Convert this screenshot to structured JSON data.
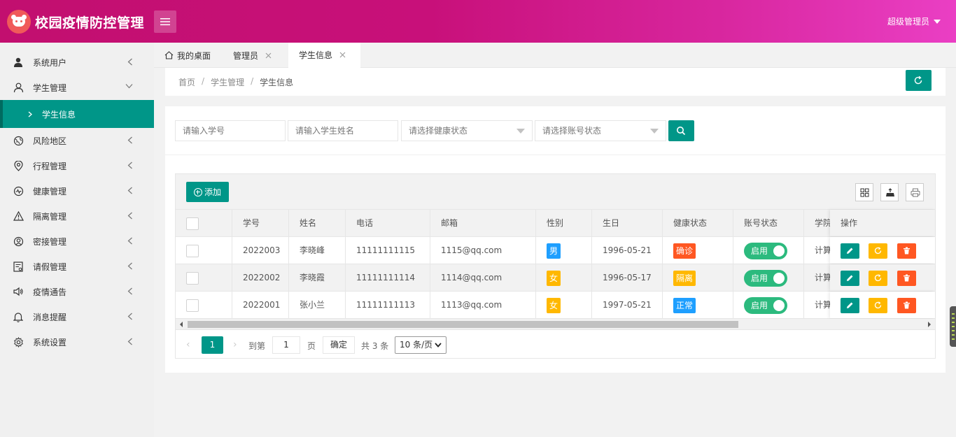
{
  "app": {
    "title": "校园疫情防控管理",
    "user": "超级管理员"
  },
  "sidebar": {
    "items": [
      {
        "label": "系统用户",
        "icon": "user-icon"
      },
      {
        "label": "学生管理",
        "icon": "person-outline-icon",
        "expanded": true
      },
      {
        "label": "风险地区",
        "icon": "globe-icon"
      },
      {
        "label": "行程管理",
        "icon": "location-icon"
      },
      {
        "label": "健康管理",
        "icon": "pulse-icon"
      },
      {
        "label": "隔离管理",
        "icon": "warning-icon"
      },
      {
        "label": "密接管理",
        "icon": "contact-icon"
      },
      {
        "label": "请假管理",
        "icon": "form-icon"
      },
      {
        "label": "疫情通告",
        "icon": "speaker-icon"
      },
      {
        "label": "消息提醒",
        "icon": "bell-icon"
      },
      {
        "label": "系统设置",
        "icon": "gear-icon"
      }
    ],
    "active_sub": "学生信息"
  },
  "tabs": [
    {
      "label": "我的桌面"
    },
    {
      "label": "管理员"
    },
    {
      "label": "学生信息",
      "active": true
    }
  ],
  "breadcrumb": {
    "home": "首页",
    "parent": "学生管理",
    "current": "学生信息",
    "sep": "/"
  },
  "filters": {
    "student_id_placeholder": "请输入学号",
    "student_name_placeholder": "请输入学生姓名",
    "health_status_placeholder": "请选择健康状态",
    "account_status_placeholder": "请选择账号状态"
  },
  "toolbar": {
    "add_label": "添加"
  },
  "table": {
    "columns": [
      "学号",
      "姓名",
      "电话",
      "邮箱",
      "性别",
      "生日",
      "健康状态",
      "账号状态",
      "学院",
      "操作"
    ],
    "rows": [
      {
        "id": "2022003",
        "name": "李晓峰",
        "phone": "11111111115",
        "email": "1115@qq.com",
        "gender": "男",
        "birthday": "1996-05-21",
        "health": "确诊",
        "account": "启用",
        "college": "计算"
      },
      {
        "id": "2022002",
        "name": "李晓霞",
        "phone": "11111111114",
        "email": "1114@qq.com",
        "gender": "女",
        "birthday": "1996-05-17",
        "health": "隔离",
        "account": "启用",
        "college": "计算"
      },
      {
        "id": "2022001",
        "name": "张小兰",
        "phone": "11111111113",
        "email": "1113@qq.com",
        "gender": "女",
        "birthday": "1997-05-21",
        "health": "正常",
        "account": "启用",
        "college": "计算"
      }
    ]
  },
  "pagination": {
    "current_page": "1",
    "goto_label": "到第",
    "goto_value": "1",
    "page_label": "页",
    "confirm_label": "确定",
    "total_label": "共 3 条",
    "page_size": "10 条/页"
  },
  "colors": {
    "header_start": "#c20f6f",
    "header_end": "#ea3fc4",
    "primary": "#009688",
    "blue": "#1e9fff",
    "orange": "#ffb800",
    "red": "#ff5722",
    "switch_on": "#2cba7e"
  }
}
